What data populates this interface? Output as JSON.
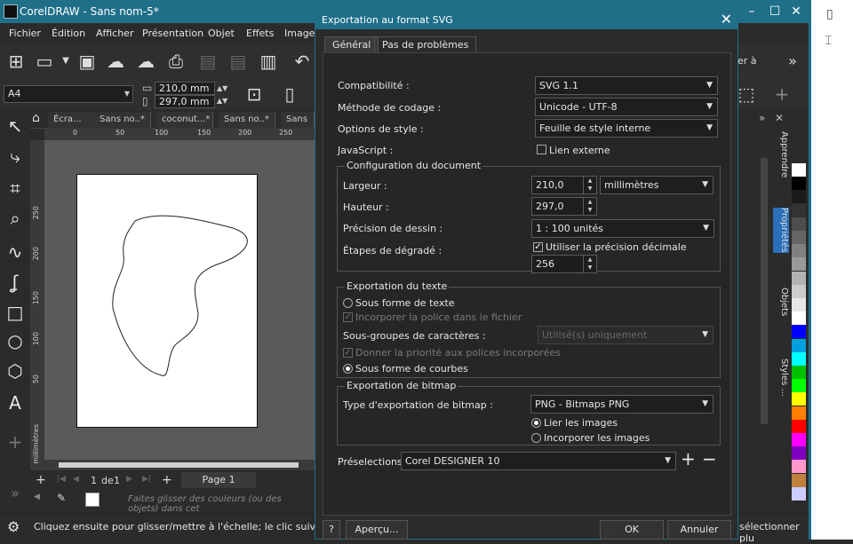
{
  "window": {
    "title": "CorelDRAW - Sans nom-5*"
  },
  "menu": [
    "Fichier",
    "Édition",
    "Afficher",
    "Présentation",
    "Objet",
    "Effets",
    "Images"
  ],
  "toolbar": {
    "right_label": "er à"
  },
  "propbar": {
    "page_size": "A4",
    "width": "210,0 mm",
    "height": "297,0 mm"
  },
  "doc_tabs": [
    "Écra...",
    "Sans no..*",
    "coconut...*",
    "Sans no..*",
    "Sans no"
  ],
  "ruler": {
    "h_ticks": [
      "0",
      "50",
      "100",
      "150",
      "200",
      "250"
    ],
    "v_ticks": [
      "250",
      "200",
      "150",
      "100",
      "50"
    ],
    "v_unit": "millimètres"
  },
  "page_nav": {
    "current": "1",
    "of": "de",
    "total": "1",
    "page_label": "Page 1"
  },
  "color_hint": "Faites glisser des couleurs (ou des objets) dans cet",
  "status": {
    "text": "Cliquez ensuite pour glisser/mettre à l'échelle; le clic suivant fera pivoter/in",
    "right": "sélectionner plu"
  },
  "dockers": [
    "Apprendre",
    "Propriétés",
    "Objets",
    "Styles ..."
  ],
  "palette": [
    "#ffffff",
    "#000000",
    "#1a1a1a",
    "#333333",
    "#4d4d4d",
    "#666666",
    "#808080",
    "#999999",
    "#b3b3b3",
    "#cccccc",
    "#e6e6e6",
    "#ffffff",
    "#0000ff",
    "#00a0e0",
    "#00ffff",
    "#00c000",
    "#00ff00",
    "#ffff00",
    "#ff8000",
    "#ff0000",
    "#ff00ff",
    "#8000c0",
    "#ff99cc",
    "#c08040",
    "#ccccff"
  ],
  "dialog": {
    "title": "Exportation au format SVG",
    "tabs": [
      "Général",
      "Pas de problèmes"
    ],
    "compat_label": "Compatibilité :",
    "compat_value": "SVG 1.1",
    "encoding_label": "Méthode de codage :",
    "encoding_value": "Unicode - UTF-8",
    "style_label": "Options de style :",
    "style_value": "Feuille de style interne",
    "js_label": "JavaScript :",
    "link_external": "Lien externe",
    "doc_config": {
      "title": "Configuration du document",
      "width_label": "Largeur :",
      "width_value": "210,0",
      "unit_value": "millimètres",
      "height_label": "Hauteur :",
      "height_value": "297,0",
      "precision_label": "Précision de dessin :",
      "precision_value": "1 : 100 unités",
      "gradient_label": "Étapes de dégradé :",
      "decimal_label": "Utiliser la précision décimale",
      "gradient_value": "256"
    },
    "text_export": {
      "title": "Exportation du texte",
      "as_text": "Sous forme de texte",
      "embed_font": "Incorporer la police dans le fichier",
      "subsets_label": "Sous-groupes de caractères :",
      "subsets_value": "Utilisé(s) uniquement",
      "priority": "Donner la priorité aux polices incorporées",
      "as_curves": "Sous forme de courbes"
    },
    "bitmap_export": {
      "title": "Exportation de bitmap",
      "type_label": "Type d'exportation de bitmap :",
      "type_value": "PNG - Bitmaps PNG",
      "link": "Lier les images",
      "embed": "Incorporer les images"
    },
    "presets_label": "Préselections:",
    "presets_value": "Corel DESIGNER 10",
    "help": "?",
    "preview": "Aperçu...",
    "ok": "OK",
    "cancel": "Annuler"
  }
}
